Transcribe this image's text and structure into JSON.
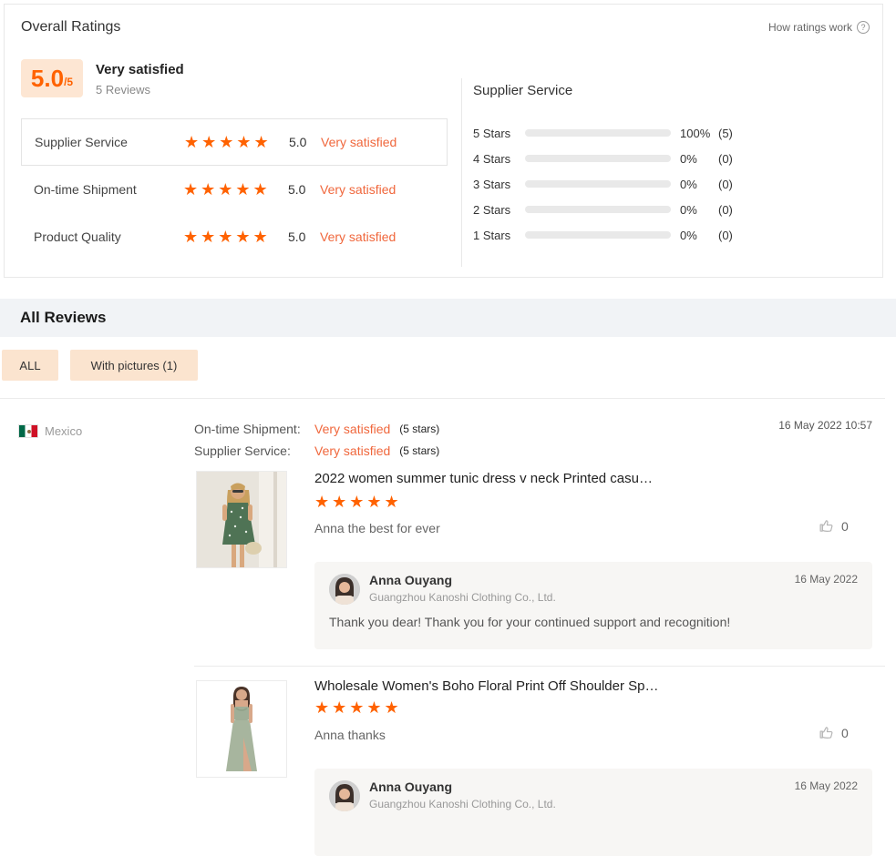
{
  "colors": {
    "accent": "#ff6200",
    "satisfied": "#f0673c",
    "badge-bg": "#fde6d3",
    "filter-bg": "#fbe4cf",
    "section-bg": "#f1f3f6",
    "reply-bg": "#f7f6f4",
    "border": "#e8e8e8",
    "bar-track": "#e9e9e9"
  },
  "overall": {
    "title": "Overall Ratings",
    "how_ratings_link": "How ratings work",
    "score": "5.0",
    "score_max": "/5",
    "verdict": "Very satisfied",
    "review_count": "5 Reviews",
    "metrics": [
      {
        "label": "Supplier Service",
        "stars": 5,
        "score": "5.0",
        "verdict": "Very satisfied"
      },
      {
        "label": "On-time Shipment",
        "stars": 5,
        "score": "5.0",
        "verdict": "Very satisfied"
      },
      {
        "label": "Product Quality",
        "stars": 5,
        "score": "5.0",
        "verdict": "Very satisfied"
      }
    ]
  },
  "breakdown": {
    "title": "Supplier Service",
    "rows": [
      {
        "label": "5 Stars",
        "fill": 100,
        "percent": "100%",
        "count": "(5)"
      },
      {
        "label": "4 Stars",
        "fill": 0,
        "percent": "0%",
        "count": "(0)"
      },
      {
        "label": "3 Stars",
        "fill": 0,
        "percent": "0%",
        "count": "(0)"
      },
      {
        "label": "2 Stars",
        "fill": 0,
        "percent": "0%",
        "count": "(0)"
      },
      {
        "label": "1 Stars",
        "fill": 0,
        "percent": "0%",
        "count": "(0)"
      }
    ]
  },
  "reviews": {
    "section_title": "All Reviews",
    "filters": [
      {
        "label": "ALL"
      },
      {
        "label": "With pictures (1)"
      }
    ],
    "review": {
      "country": "Mexico",
      "date": "16 May 2022 10:57",
      "attributes": [
        {
          "label": "On-time Shipment:",
          "verdict": "Very satisfied",
          "note": "(5 stars)"
        },
        {
          "label": "Supplier Service:",
          "verdict": "Very satisfied",
          "note": "(5 stars)"
        }
      ],
      "items": [
        {
          "title": "2022 women summer tunic dress v neck Printed casu…",
          "stars": 5,
          "comment": "Anna the best for ever",
          "likes": "0",
          "reply": {
            "name": "Anna Ouyang",
            "company": "Guangzhou Kanoshi Clothing Co., Ltd.",
            "date": "16 May 2022",
            "text": "Thank you dear! Thank you for your continued support and recognition!"
          }
        },
        {
          "title": "Wholesale Women's Boho Floral Print Off Shoulder Sp…",
          "stars": 5,
          "comment": "Anna thanks",
          "likes": "0",
          "reply": {
            "name": "Anna Ouyang",
            "company": "Guangzhou Kanoshi Clothing Co., Ltd.",
            "date": "16 May 2022",
            "text": ""
          }
        }
      ]
    }
  }
}
